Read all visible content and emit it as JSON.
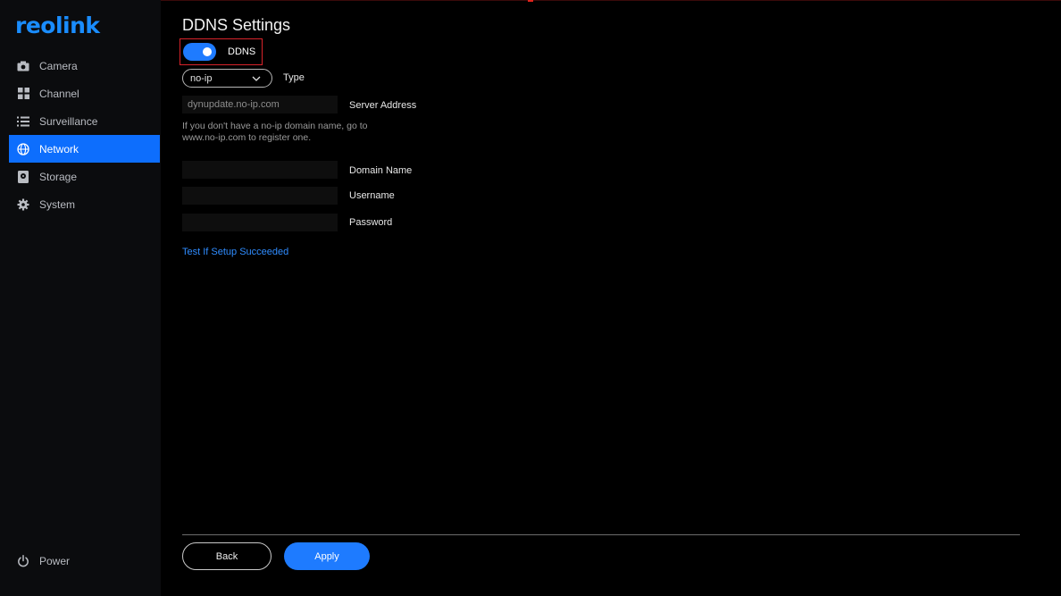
{
  "brand": {
    "logo_text": "reolink",
    "accent": "#1a8dff"
  },
  "sidebar": {
    "items": [
      {
        "label": "Camera",
        "icon": "camera-icon",
        "active": false
      },
      {
        "label": "Channel",
        "icon": "grid-icon",
        "active": false
      },
      {
        "label": "Surveillance",
        "icon": "list-icon",
        "active": false
      },
      {
        "label": "Network",
        "icon": "globe-icon",
        "active": true
      },
      {
        "label": "Storage",
        "icon": "disk-icon",
        "active": false
      },
      {
        "label": "System",
        "icon": "gear-icon",
        "active": false
      }
    ],
    "power_label": "Power"
  },
  "main": {
    "title": "DDNS Settings",
    "ddns_toggle": {
      "label": "DDNS",
      "on": true
    },
    "type": {
      "label": "Type",
      "selected": "no-ip"
    },
    "server_address": {
      "label": "Server Address",
      "value": "dynupdate.no-ip.com"
    },
    "hint": "If you don't have a no-ip domain name, go to www.no-ip.com to register one.",
    "domain_name": {
      "label": "Domain Name",
      "value": ""
    },
    "username": {
      "label": "Username",
      "value": ""
    },
    "password": {
      "label": "Password",
      "value": ""
    },
    "test_link": "Test If Setup Succeeded",
    "back_label": "Back",
    "apply_label": "Apply"
  }
}
